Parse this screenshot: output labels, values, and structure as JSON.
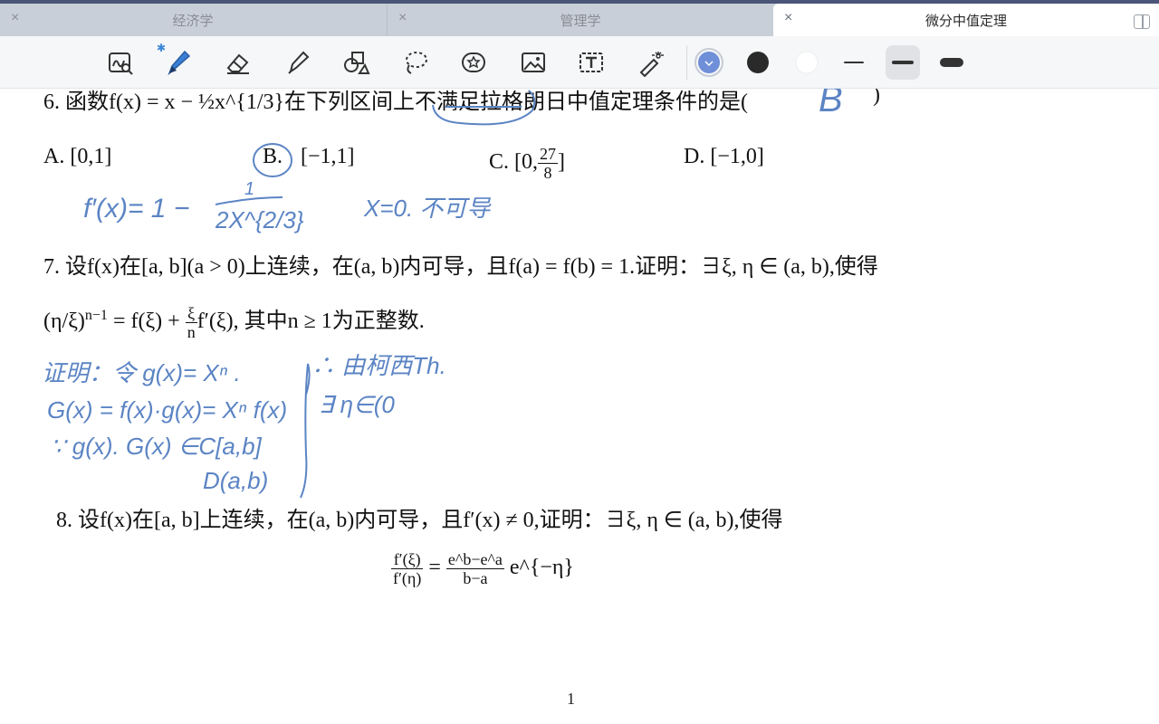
{
  "tabs": [
    {
      "label": "经济学",
      "close": "×"
    },
    {
      "label": "管理学",
      "close": "×"
    },
    {
      "label": "微分中值定理",
      "close": "×"
    }
  ],
  "toolbar": {
    "bluetooth": "✱",
    "tools": [
      "lasso-zoom-icon",
      "pen-icon",
      "eraser-icon",
      "highlighter-icon",
      "shapes-icon",
      "lasso-icon",
      "sticker-icon",
      "image-icon",
      "text-icon",
      "laser-pointer-icon"
    ],
    "colors": {
      "selected": "#6f8fd8",
      "black": "#2a2a2a",
      "white": "#ffffff"
    }
  },
  "content": {
    "q6": "6. 函数f(x) = x − ½x^{1/3}在下列区间上不满足拉格朗日中值定理条件的是(",
    "q6_end": ")",
    "options": [
      "A.  [0,1]",
      "B.",
      "[−1,1]",
      "C.  [0,",
      "27",
      "8",
      "]",
      "D.  [−1,0]"
    ],
    "q7_line1": "7. 设f(x)在[a, b](a > 0)上连续，在(a, b)内可导，且f(a) = f(b) = 1.证明：∃ξ, η ∈ (a, b),使得",
    "q7_line2_pre": "(η/ξ)",
    "q7_exp": "n−1",
    "q7_line2": " = f(ξ) + ",
    "q7_frac_num": "ξ",
    "q7_frac_den": "n",
    "q7_line2_post": "f′(ξ), 其中n ≥ 1为正整数.",
    "q8_line1": "8. 设f(x)在[a, b]上连续，在(a, b)内可导，且f′(x) ≠ 0,证明：∃ξ, η ∈ (a, b),使得",
    "q8_lhs_num": "f′(ξ)",
    "q8_lhs_den": "f′(η)",
    "q8_eq": "=",
    "q8_rhs_num": "e^b−e^a",
    "q8_rhs_den": "b−a",
    "q8_tail": "e^{−η}",
    "page_number": "1"
  },
  "handwriting": {
    "answer": "B",
    "deriv": "f′(x)= 1 −",
    "deriv_num": "1",
    "deriv_den": "2X^{2/3}",
    "note_x0": "X=0. 不可导",
    "proof1": "证明：令 g(x)= Xⁿ .",
    "proof2": "G(x) = f(x)·g(x)= Xⁿ f(x)",
    "proof3": "∵ g(x). G(x) ∈C[a,b]",
    "proof4": "D(a,b)",
    "right1": "∴ 由柯西Th.",
    "right2": "∃ η∈(0"
  }
}
